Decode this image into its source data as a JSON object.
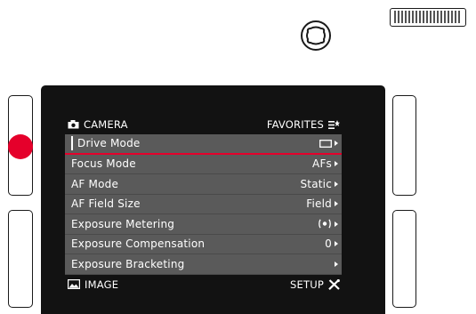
{
  "menu": {
    "header": {
      "left_label": "CAMERA",
      "right_label": "FAVORITES"
    },
    "items": [
      {
        "label": "Drive Mode",
        "value": "",
        "value_icon": "single-frame-icon",
        "selected": true
      },
      {
        "label": "Focus Mode",
        "value": "AFs"
      },
      {
        "label": "AF Mode",
        "value": "Static"
      },
      {
        "label": "AF Field Size",
        "value": "Field"
      },
      {
        "label": "Exposure Metering",
        "value": "",
        "value_icon": "spot-metering-icon"
      },
      {
        "label": "Exposure Compensation",
        "value": "0"
      },
      {
        "label": "Exposure Bracketing",
        "value": ""
      }
    ],
    "footer": {
      "left_label": "IMAGE",
      "right_label": "SETUP"
    }
  },
  "colors": {
    "selection_accent": "#e5002b",
    "row_background": "#5a5a5a",
    "screen_background": "#121212"
  },
  "icons": {
    "header_left": "camera-icon",
    "header_right": "favorites-icon",
    "footer_left": "image-icon",
    "footer_right": "setup-tools-icon",
    "top_button": "directional-pad-icon",
    "top_right_control": "thumbwheel-dial-icon"
  }
}
